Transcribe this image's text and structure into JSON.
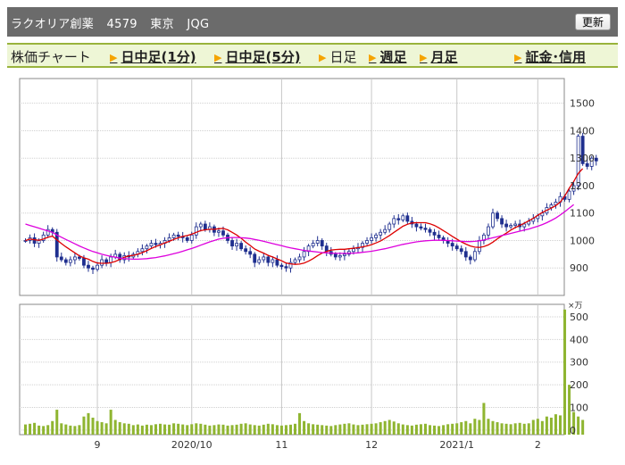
{
  "header": {
    "name": "ラクオリア創薬",
    "code": "4579",
    "market": "東京",
    "segment": "JQG",
    "refresh_label": "更新"
  },
  "tabs": [
    {
      "label": "株価チャート",
      "link": false,
      "arrow": false
    },
    {
      "label": "日中足(1分)",
      "link": true,
      "arrow": true
    },
    {
      "label": "日中足(5分)",
      "link": true,
      "arrow": true
    },
    {
      "label": "日足",
      "link": false,
      "arrow": true
    },
    {
      "label": "週足",
      "link": true,
      "arrow": true
    },
    {
      "label": "月足",
      "link": true,
      "arrow": true
    },
    {
      "label": "証金･信用",
      "link": true,
      "arrow": true
    }
  ],
  "chart_data": [
    {
      "type": "candlestick",
      "y_ticks": [
        900,
        1000,
        1100,
        1200,
        1300,
        1400,
        1500
      ],
      "ylim": [
        800,
        1590
      ],
      "x_labels": [
        "9",
        "2020/10",
        "11",
        "12",
        "2021/1",
        "2"
      ],
      "x_label_positions": [
        16,
        37,
        57,
        77,
        96,
        114
      ],
      "n_days": 120,
      "grid": true,
      "colors": {
        "up": "#ffffff",
        "down": "#1f2f8f",
        "ma_short": "#dd0000",
        "ma_long": "#dd00dd",
        "volume_profile": "#bdbdbd"
      },
      "series": [
        {
          "name": "close",
          "values": [
            1000,
            1010,
            990,
            1000,
            1020,
            1040,
            1030,
            940,
            930,
            920,
            930,
            940,
            935,
            910,
            900,
            895,
            910,
            930,
            920,
            940,
            950,
            930,
            945,
            940,
            950,
            960,
            970,
            980,
            990,
            985,
            990,
            1000,
            1010,
            1020,
            1015,
            1010,
            1000,
            1020,
            1050,
            1060,
            1040,
            1050,
            1030,
            1035,
            1020,
            1000,
            980,
            990,
            970,
            960,
            950,
            920,
            930,
            940,
            920,
            930,
            910,
            905,
            900,
            920,
            930,
            940,
            960,
            980,
            990,
            1000,
            980,
            960,
            950,
            940,
            945,
            950,
            960,
            970,
            975,
            990,
            1000,
            1010,
            1020,
            1030,
            1040,
            1060,
            1080,
            1075,
            1090,
            1070,
            1060,
            1050,
            1045,
            1040,
            1030,
            1020,
            1010,
            1000,
            990,
            980,
            970,
            960,
            940,
            930,
            960,
            1000,
            1020,
            1050,
            1100,
            1080,
            1060,
            1050,
            1055,
            1060,
            1050,
            1060,
            1070,
            1080,
            1090,
            1100,
            1120,
            1130,
            1140,
            1160,
            1150,
            1180,
            1200,
            1380,
            1280,
            1270,
            1300,
            1290
          ]
        },
        {
          "name": "MA short",
          "values": [
            1000,
            1005,
            1003,
            1001,
            1005,
            1012,
            1016,
            1002,
            989,
            977,
            966,
            955,
            944,
            937,
            932,
            924,
            918,
            917,
            917,
            919,
            924,
            931,
            939,
            944,
            946,
            950,
            956,
            963,
            971,
            978,
            984,
            991,
            997,
            1004,
            1010,
            1015,
            1018,
            1023,
            1030,
            1036,
            1039,
            1041,
            1041,
            1043,
            1044,
            1039,
            1030,
            1020,
            1008,
            994,
            982,
            969,
            961,
            954,
            946,
            940,
            933,
            926,
            918,
            915,
            913,
            914,
            918,
            925,
            934,
            945,
            954,
            960,
            965,
            967,
            968,
            968,
            970,
            972,
            974,
            977,
            980,
            985,
            991,
            998,
            1008,
            1018,
            1030,
            1041,
            1052,
            1059,
            1064,
            1065,
            1065,
            1065,
            1061,
            1055,
            1046,
            1036,
            1026,
            1015,
            1005,
            995,
            987,
            980,
            976,
            975,
            978,
            984,
            994,
            1006,
            1017,
            1027,
            1038,
            1047,
            1055,
            1063,
            1072,
            1081,
            1092,
            1102,
            1110,
            1118,
            1127,
            1140,
            1162,
            1190,
            1215,
            1244,
            1262
          ]
        },
        {
          "name": "MA long",
          "values": [
            1060,
            1055,
            1050,
            1045,
            1040,
            1035,
            1030,
            1020,
            1012,
            1004,
            996,
            988,
            980,
            973,
            966,
            960,
            955,
            950,
            946,
            942,
            939,
            936,
            934,
            933,
            932,
            932,
            933,
            934,
            936,
            938,
            941,
            944,
            948,
            952,
            956,
            961,
            966,
            971,
            977,
            983,
            989,
            995,
            1000,
            1005,
            1008,
            1010,
            1011,
            1011,
            1010,
            1009,
            1007,
            1004,
            1001,
            997,
            993,
            989,
            985,
            981,
            977,
            973,
            970,
            967,
            964,
            962,
            960,
            958,
            956,
            955,
            954,
            953,
            953,
            953,
            953,
            954,
            955,
            957,
            959,
            961,
            964,
            967,
            970,
            974,
            978,
            982,
            986,
            989,
            992,
            995,
            997,
            999,
            1000,
            1001,
            1001,
            1001,
            1000,
            999,
            998,
            997,
            996,
            996,
            997,
            999,
            1002,
            1006,
            1010,
            1014,
            1018,
            1022,
            1026,
            1030,
            1034,
            1038,
            1042,
            1047,
            1052,
            1058,
            1065,
            1073,
            1082,
            1093,
            1105,
            1118,
            1131
          ]
        }
      ]
    },
    {
      "type": "bar",
      "unit": "×万",
      "y_ticks": [
        0,
        100,
        200,
        300,
        400,
        500
      ],
      "ylim": [
        -20,
        555
      ],
      "x_labels": [
        "9",
        "2020/10",
        "11",
        "12",
        "2021/1",
        "2"
      ],
      "colors": {
        "bar": "#8fb531"
      },
      "series": [
        {
          "name": "volume",
          "values": [
            25,
            28,
            32,
            20,
            18,
            22,
            40,
            90,
            30,
            25,
            20,
            18,
            22,
            60,
            75,
            55,
            40,
            35,
            30,
            90,
            45,
            35,
            30,
            28,
            22,
            25,
            20,
            24,
            22,
            26,
            28,
            25,
            24,
            30,
            28,
            25,
            22,
            26,
            30,
            28,
            24,
            20,
            22,
            25,
            24,
            20,
            22,
            24,
            28,
            30,
            25,
            22,
            20,
            24,
            28,
            26,
            22,
            20,
            22,
            24,
            28,
            75,
            40,
            30,
            26,
            24,
            22,
            20,
            18,
            22,
            25,
            28,
            30,
            25,
            22,
            24,
            26,
            28,
            30,
            35,
            40,
            45,
            38,
            30,
            25,
            22,
            20,
            24,
            26,
            28,
            22,
            20,
            18,
            22,
            26,
            28,
            30,
            35,
            40,
            30,
            50,
            45,
            120,
            50,
            40,
            35,
            30,
            28,
            26,
            30,
            32,
            28,
            30,
            45,
            50,
            40,
            60,
            55,
            70,
            65,
            532,
            200,
            80,
            60,
            45
          ]
        }
      ]
    }
  ]
}
